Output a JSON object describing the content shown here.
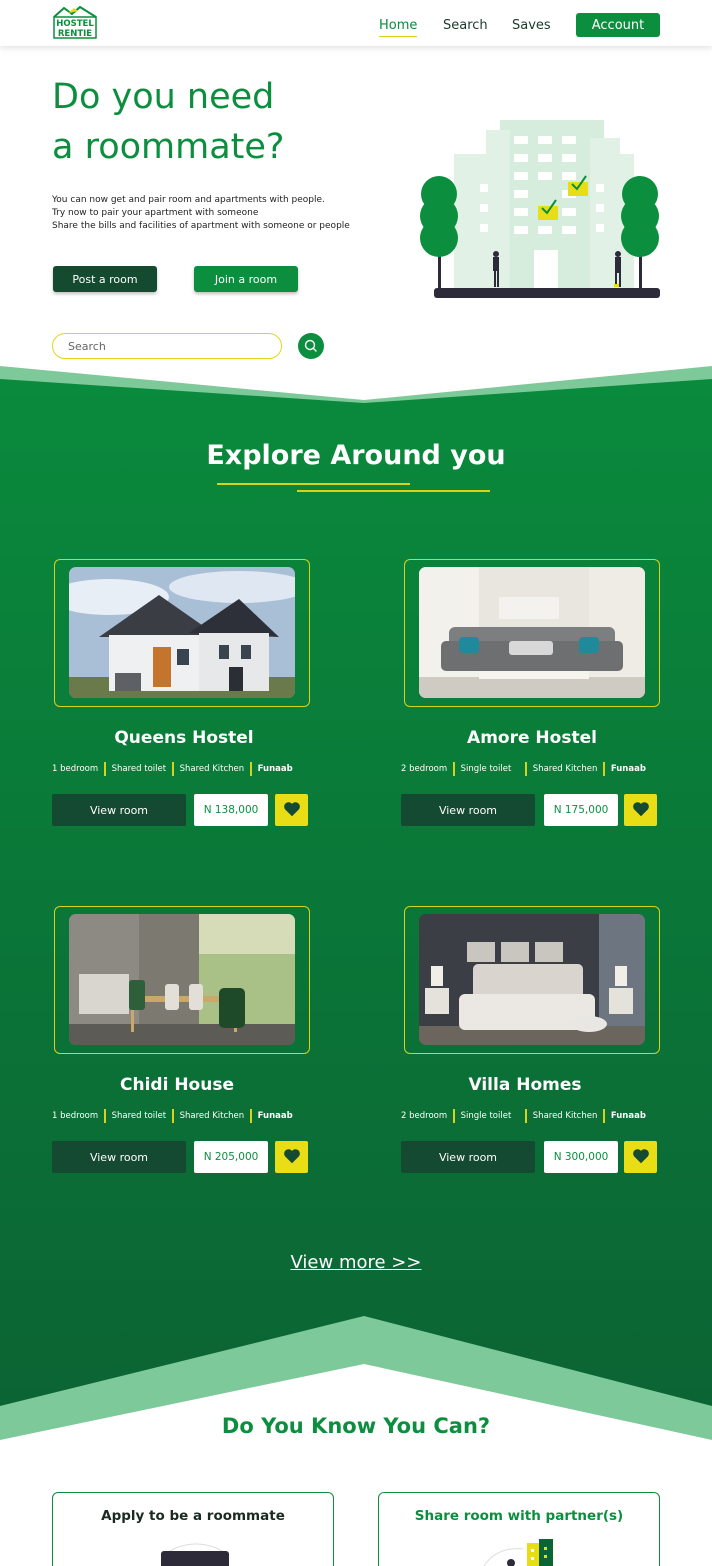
{
  "brand": {
    "logo_line1": "HOSTEL",
    "logo_line2": "RENTIE"
  },
  "nav": {
    "home": "Home",
    "search": "Search",
    "saves": "Saves",
    "account": "Account"
  },
  "hero": {
    "title_line1": "Do you need",
    "title_line2": "a roommate?",
    "desc_line1": "You can now get and pair room and apartments with people.",
    "desc_line2": "Try now to pair your apartment with someone",
    "desc_line3": "Share the bills and facilities of apartment with someone or people",
    "post_btn": "Post a room",
    "join_btn": "Join a room",
    "search_placeholder": "Search"
  },
  "explore": {
    "title": "Explore Around you",
    "view_more": "View more >>",
    "listings": [
      {
        "name": "Queens Hostel",
        "f1": "1 bedroom",
        "f2": "Shared toilet",
        "f3": "Shared Kitchen",
        "loc": "Funaab",
        "view": "View room",
        "price": "N 138,000",
        "photo": "house-exterior"
      },
      {
        "name": "Amore  Hostel",
        "f1": "2 bedroom",
        "f2": "Single toilet",
        "f3": "Shared Kitchen",
        "loc": "Funaab",
        "view": "View room",
        "price": "N 175,000",
        "photo": "living-room-sofa"
      },
      {
        "name": "Chidi House",
        "f1": "1 bedroom",
        "f2": "Shared toilet",
        "f3": "Shared Kitchen",
        "loc": "Funaab",
        "view": "View room",
        "price": "N 205,000",
        "photo": "dining-room"
      },
      {
        "name": "Villa Homes",
        "f1": "2 bedroom",
        "f2": "Single toilet",
        "f3": "Shared Kitchen",
        "loc": "Funaab",
        "view": "View room",
        "price": "N 300,000",
        "photo": "bedroom"
      }
    ]
  },
  "know": {
    "title": "Do You Know You Can?",
    "card1": "Apply to be a roommate",
    "card2": "Share room with partner(s)"
  },
  "colors": {
    "brand_green": "#0b8f3f",
    "dark_green": "#134a30",
    "accent_yellow": "#e9dd16"
  }
}
